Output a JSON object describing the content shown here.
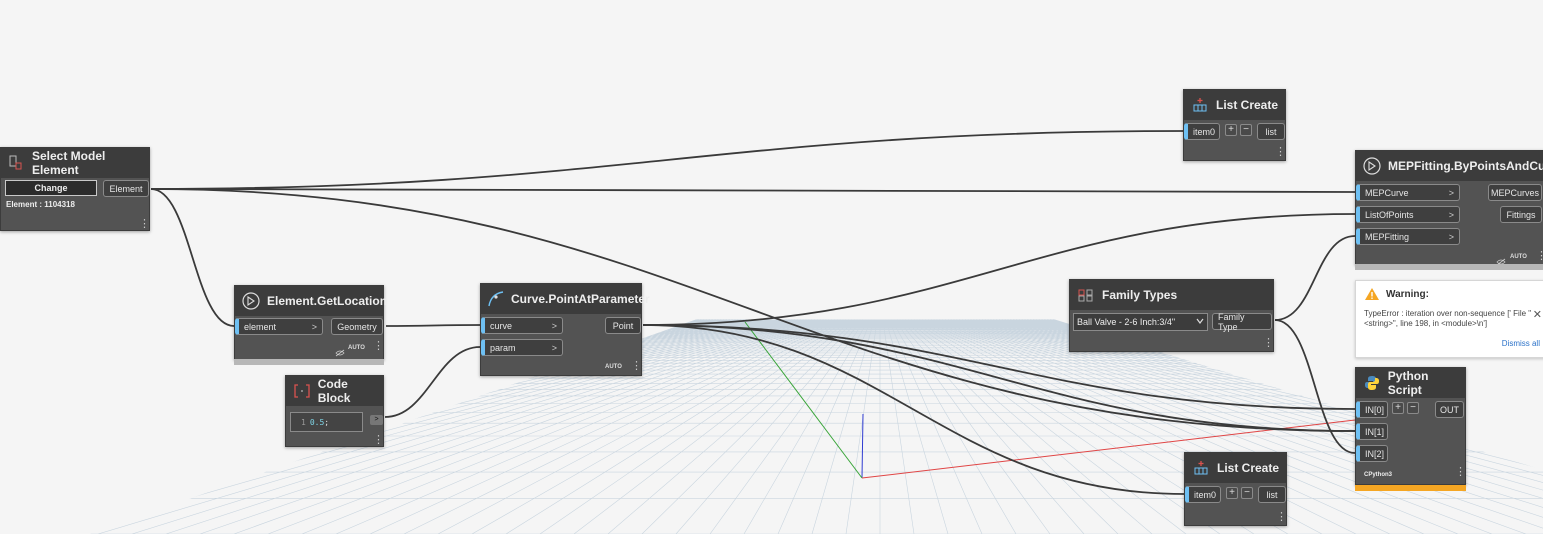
{
  "colors": {
    "canvas": "#f5f5f5",
    "node_body": "#535353",
    "node_header": "#3c3c3c",
    "port_accent": "#6ec0f3",
    "wire": "#3a3a3a",
    "warning_bar": "#f5a623"
  },
  "nodes": {
    "select_model": {
      "title": "Select Model Element",
      "change_button": "Change",
      "output": "Element",
      "info": "Element : 1104318"
    },
    "element_getlocation": {
      "title": "Element.GetLocation",
      "input": "element",
      "output": "Geometry",
      "lacing": "AUTO"
    },
    "curve_pointatparameter": {
      "title": "Curve.PointAtParameter",
      "inputs": [
        "curve",
        "param"
      ],
      "output": "Point",
      "lacing": "AUTO"
    },
    "code_block": {
      "title": "Code Block",
      "line_number": "1",
      "code_value": "0.5",
      "code_terminator": ";",
      "output_arrow": ">"
    },
    "list_create_top": {
      "title": "List Create",
      "input": "item0",
      "output": "list"
    },
    "list_create_bottom": {
      "title": "List Create",
      "input": "item0",
      "output": "list"
    },
    "family_types": {
      "title": "Family Types",
      "selected": "Ball Valve - 2-6 Inch:3/4\"",
      "output": "Family Type"
    },
    "mepfitting": {
      "title": "MEPFitting.ByPointsAndCurve",
      "inputs": [
        "MEPCurve",
        "ListOfPoints",
        "MEPFitting"
      ],
      "outputs": [
        "MEPCurves",
        "Fittings"
      ],
      "lacing": "AUTO"
    },
    "python_script": {
      "title": "Python Script",
      "inputs": [
        "IN[0]",
        "IN[1]",
        "IN[2]"
      ],
      "output": "OUT",
      "engine": "CPython3"
    }
  },
  "warning": {
    "title": "Warning:",
    "message": "TypeError : iteration over non-sequence [' File \"<string>\", line 198, in <module>\\n']",
    "dismiss": "Dismiss all"
  },
  "icons": {
    "add": "+",
    "remove": "−",
    "arrow": ">",
    "menu": "⋮",
    "close": "✕"
  }
}
